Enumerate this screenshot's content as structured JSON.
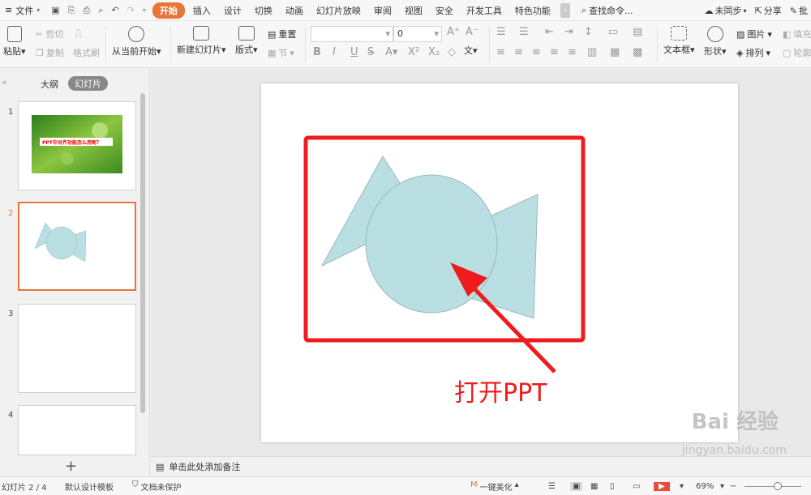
{
  "menubar": {
    "file_label": "文件",
    "tabs": [
      "开始",
      "插入",
      "设计",
      "切换",
      "动画",
      "幻灯片放映",
      "审阅",
      "视图",
      "安全",
      "开发工具",
      "特色功能"
    ],
    "active_tab": "开始",
    "search_label": "查找命令...",
    "sync_label": "未同步",
    "share_label": "分享",
    "comment_label": "批"
  },
  "ribbon": {
    "paste_label": "粘贴",
    "cut_label": "剪切",
    "copy_label": "复制",
    "format_painter_label": "格式刷",
    "from_current_label": "从当前开始",
    "new_slide_label": "新建幻灯片",
    "layout_label": "版式",
    "reset_label": "重置",
    "section_label": "节",
    "font_name_value": "",
    "font_size_value": "0",
    "textbox_label": "文本框",
    "shape_label": "形状",
    "picture_label": "图片",
    "arrange_label": "排列",
    "fill_label": "填充",
    "outline_label": "轮廓",
    "wen_label": "文"
  },
  "leftpanel": {
    "outline_tab": "大纲",
    "slides_tab": "幻灯片",
    "thumb1_number": "1",
    "thumb1_text": "PPT中对齐功能怎么用呢？",
    "thumb2_number": "2",
    "thumb3_number": "3",
    "thumb4_number": "4"
  },
  "slide": {
    "annotation_text": "打开PPT",
    "shape_fill": "#b9dfe2",
    "highlight_color": "#ee1c1c"
  },
  "notes": {
    "placeholder": "单击此处添加备注"
  },
  "statusbar": {
    "slide_indicator": "幻灯片 2 / 4",
    "theme": "默认设计模板",
    "doc_status": "文档未保护",
    "beautify_label": "一键美化",
    "zoom": "69%"
  },
  "watermark": {
    "line1": "Bai 经验",
    "line2": "jingyan.baidu.com"
  }
}
